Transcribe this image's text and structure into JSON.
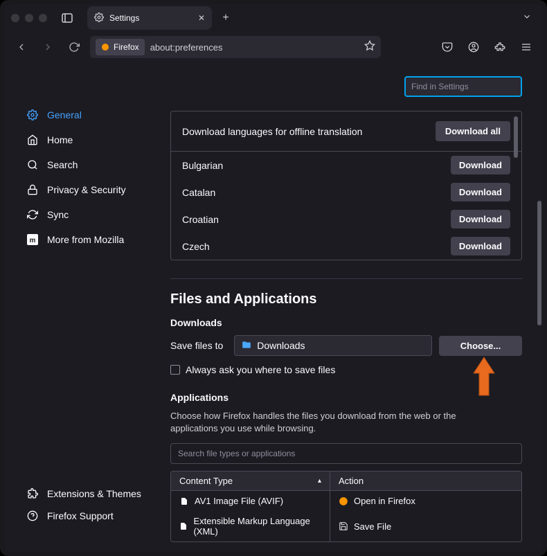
{
  "tab": {
    "title": "Settings"
  },
  "url": {
    "brand": "Firefox",
    "address": "about:preferences"
  },
  "search_settings": {
    "placeholder": "Find in Settings"
  },
  "sidebar": {
    "items": [
      {
        "label": "General",
        "icon": "gear-icon",
        "active": true
      },
      {
        "label": "Home",
        "icon": "home-icon",
        "active": false
      },
      {
        "label": "Search",
        "icon": "search-icon",
        "active": false
      },
      {
        "label": "Privacy & Security",
        "icon": "lock-icon",
        "active": false
      },
      {
        "label": "Sync",
        "icon": "sync-icon",
        "active": false
      },
      {
        "label": "More from Mozilla",
        "icon": "mozilla-icon",
        "active": false
      }
    ],
    "bottom": [
      {
        "label": "Extensions & Themes",
        "icon": "puzzle-icon"
      },
      {
        "label": "Firefox Support",
        "icon": "help-icon"
      }
    ]
  },
  "translation_panel": {
    "header": "Download languages for offline translation",
    "download_all": "Download all",
    "download_label": "Download",
    "languages": [
      "Bulgarian",
      "Catalan",
      "Croatian",
      "Czech"
    ]
  },
  "files_apps": {
    "heading": "Files and Applications",
    "downloads_heading": "Downloads",
    "save_label": "Save files to",
    "folder_name": "Downloads",
    "choose_label": "Choose...",
    "ask_where_label": "Always ask you where to save files",
    "applications_heading": "Applications",
    "applications_desc": "Choose how Firefox handles the files you download from the web or the applications you use while browsing.",
    "search_types_placeholder": "Search file types or applications",
    "table": {
      "col_type": "Content Type",
      "col_action": "Action",
      "rows": [
        {
          "type": "AV1 Image File (AVIF)",
          "action": "Open in Firefox",
          "type_icon": "file-icon",
          "action_icon": "firefox-icon"
        },
        {
          "type": "Extensible Markup Language (XML)",
          "action": "Save File",
          "type_icon": "file-icon",
          "action_icon": "save-icon"
        }
      ]
    }
  }
}
